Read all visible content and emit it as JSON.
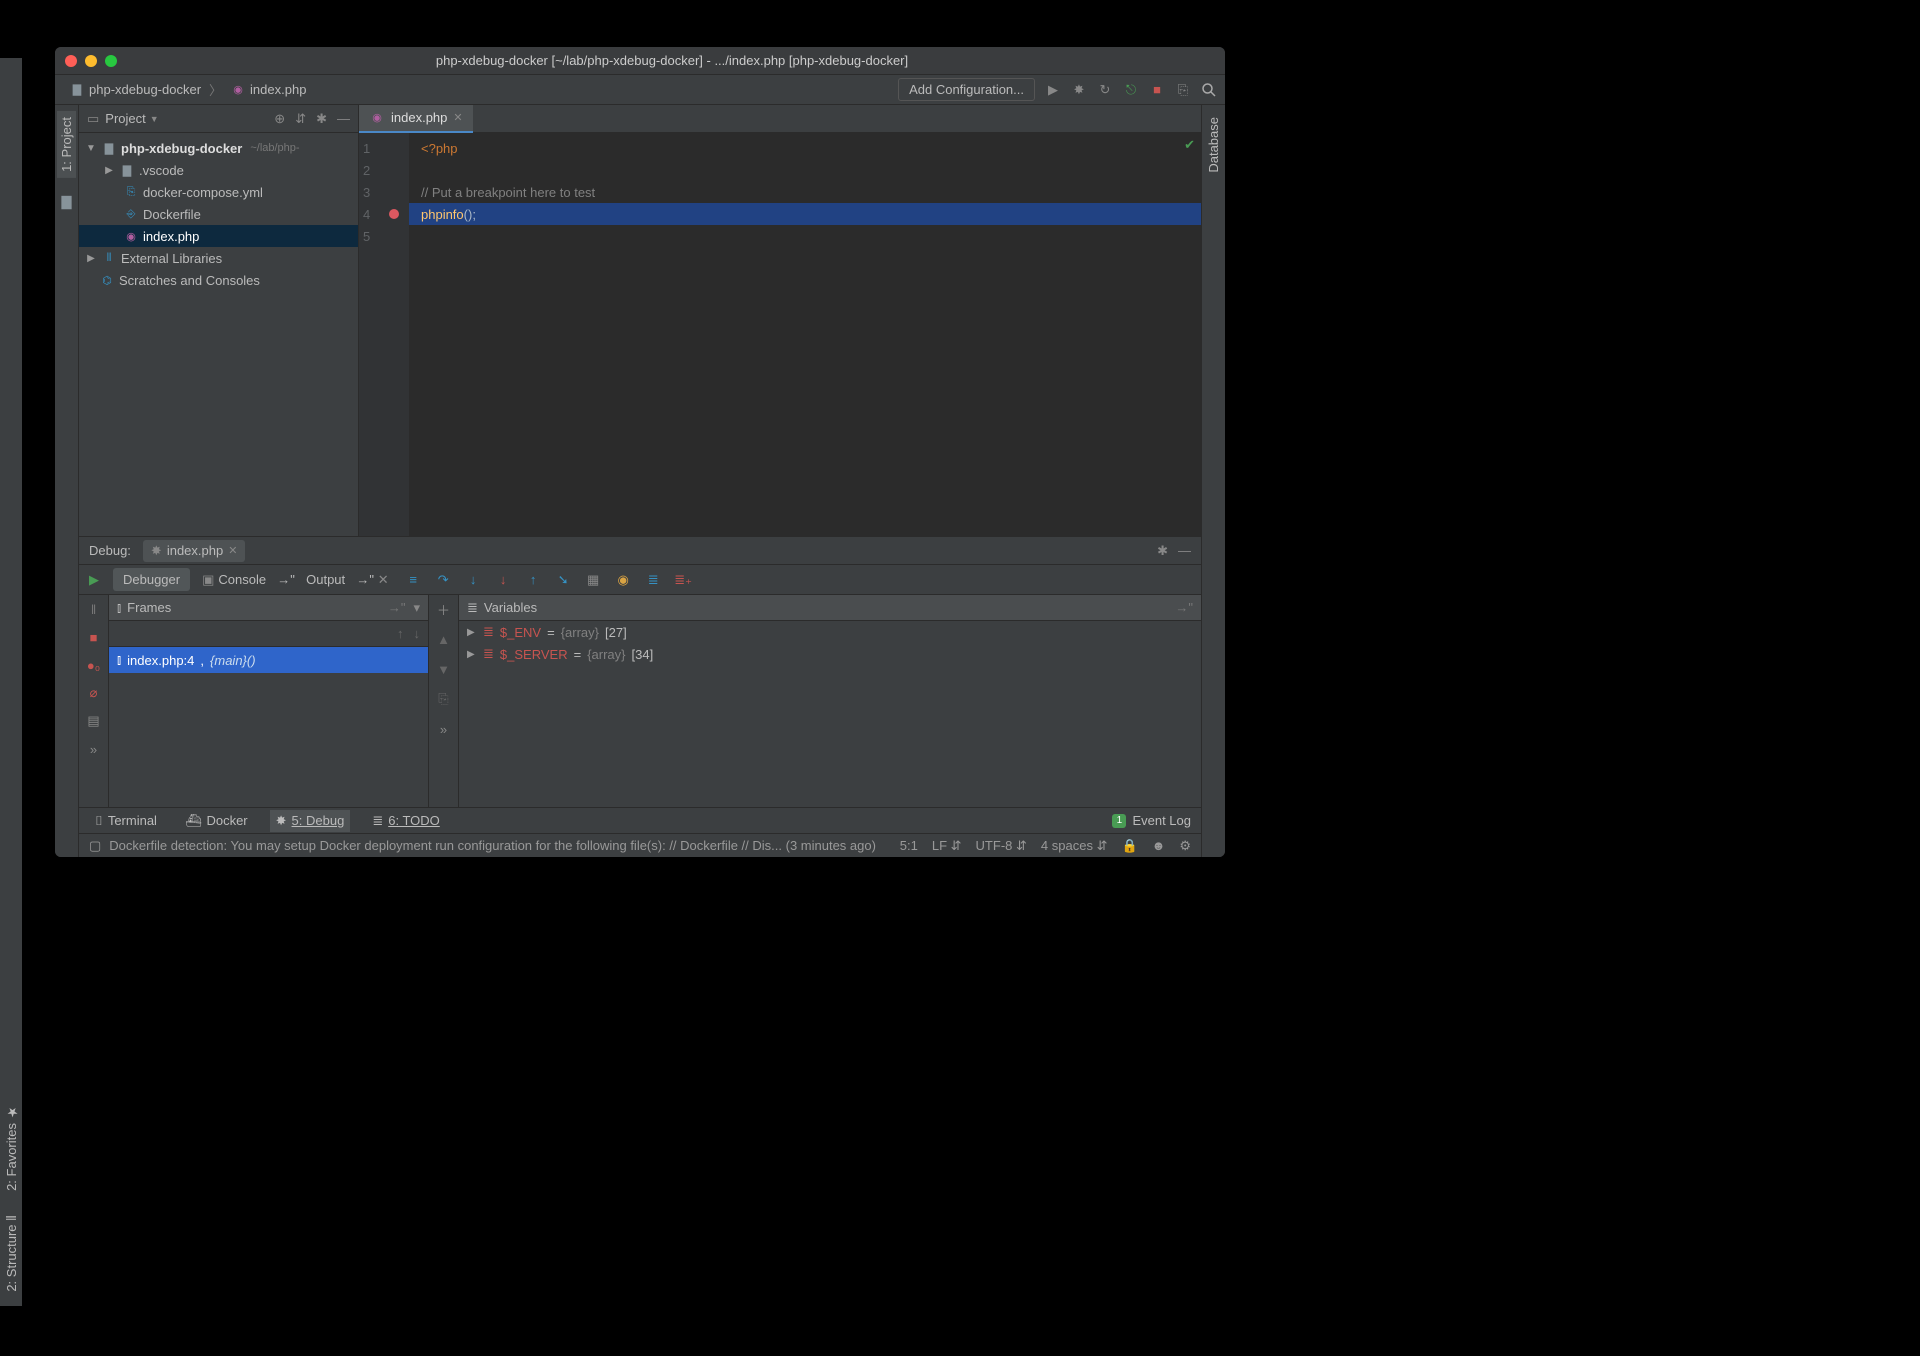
{
  "title": "php-xdebug-docker [~/lab/php-xdebug-docker] - .../index.php [php-xdebug-docker]",
  "breadcrumbs": {
    "root": "php-xdebug-docker",
    "file": "index.php"
  },
  "toolbar": {
    "add_config": "Add Configuration..."
  },
  "left_rail": {
    "project": "1: Project"
  },
  "right_rail": {
    "database": "Database"
  },
  "project_pane": {
    "title": "Project",
    "tree": {
      "root": "php-xdebug-docker",
      "root_path": "~/lab/php-",
      "children": {
        "vscode": ".vscode",
        "compose": "docker-compose.yml",
        "dockerfile": "Dockerfile",
        "index": "index.php"
      },
      "libs": "External Libraries",
      "scratches": "Scratches and Consoles"
    }
  },
  "editor": {
    "tab": "index.php",
    "lines": {
      "n1": "1",
      "n2": "2",
      "n3": "3",
      "n4": "4",
      "n5": "5",
      "l1_open": "<?php",
      "l3_comment": "// Put a breakpoint here to test",
      "l4_fn": "phpinfo",
      "l4_rest": "();"
    }
  },
  "debug": {
    "label": "Debug:",
    "tab": "index.php",
    "subtabs": {
      "debugger": "Debugger",
      "console": "Console",
      "output": "Output"
    },
    "frames": {
      "title": "Frames",
      "row_file": "index.php:4",
      "row_sep": ", ",
      "row_fn": "{main}()"
    },
    "vars": {
      "title": "Variables",
      "rows": [
        {
          "name": "$_ENV",
          "type": "{array}",
          "count": "[27]"
        },
        {
          "name": "$_SERVER",
          "type": "{array}",
          "count": "[34]"
        }
      ]
    }
  },
  "bottom_tabs": {
    "terminal": "Terminal",
    "docker": "Docker",
    "debug": "5: Debug",
    "todo": "6: TODO",
    "event_log": "Event Log"
  },
  "status": {
    "msg": "Dockerfile detection: You may setup Docker deployment run configuration for the following file(s): // Dockerfile // Dis... (3 minutes ago)",
    "pos": "5:1",
    "le": "LF",
    "enc": "UTF-8",
    "indent": "4 spaces"
  },
  "fav_rail": {
    "fav": "2: Favorites",
    "struct": "2: Structure"
  }
}
